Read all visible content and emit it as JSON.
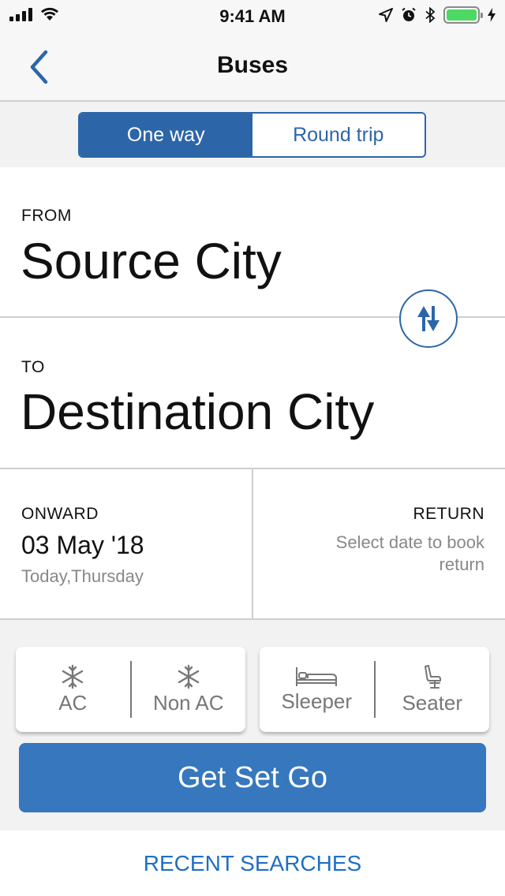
{
  "status_bar": {
    "time": "9:41 AM",
    "battery_color": "#4cd964"
  },
  "nav": {
    "title": "Buses",
    "back_icon": "chevron-left-icon"
  },
  "trip_type": {
    "options": [
      "One way",
      "Round trip"
    ],
    "selected": "One way",
    "accent": "#2d66a8"
  },
  "route": {
    "from_label": "FROM",
    "from_city": "Source City",
    "to_label": "TO",
    "to_city": "Destination City",
    "swap_icon": "swap-vertical-icon"
  },
  "dates": {
    "onward_label": "ONWARD",
    "onward_date": "03 May '18",
    "onward_day": "Today,Thursday",
    "return_label": "RETURN",
    "return_hint": "Select date to book return"
  },
  "filters": {
    "ac_label": "AC",
    "non_ac_label": "Non AC",
    "sleeper_label": "Sleeper",
    "seater_label": "Seater"
  },
  "cta": {
    "label": "Get Set Go",
    "color": "#3677bd"
  },
  "recent": {
    "label": "RECENT SEARCHES",
    "color": "#1f6fc5"
  }
}
